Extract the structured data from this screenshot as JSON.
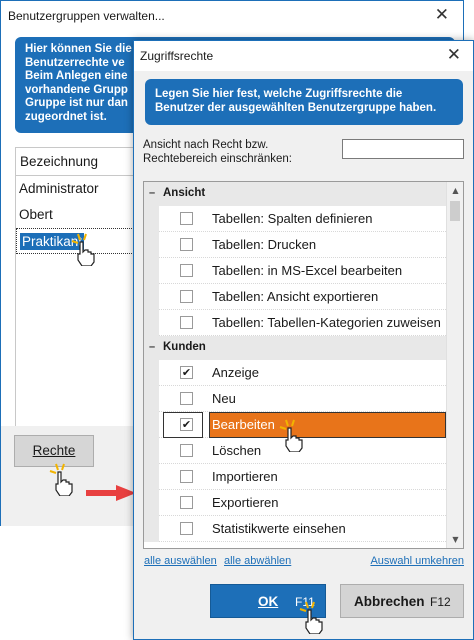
{
  "back_window": {
    "title": "Benutzergruppen verwalten...",
    "info_lines": [
      "Hier können Sie die",
      "Benutzerrechte ve",
      "Beim Anlegen eine",
      "vorhandene Grupp",
      "Gruppe ist nur dan",
      "zugeordnet ist."
    ],
    "column_header": "Bezeichnung",
    "groups": [
      "Administrator",
      "Obert",
      "Praktikant"
    ],
    "rechte_button": "Rechte"
  },
  "dialog": {
    "title": "Zugriffsrechte",
    "info_text": "Legen Sie hier fest, welche Zugriffsrechte die Benutzer der ausgewählten Benutzergruppe haben.",
    "filter_label": "Ansicht nach Recht bzw. Rechtebereich einschränken:",
    "filter_value": "",
    "sections": [
      {
        "name": "Ansicht",
        "items": [
          {
            "label": "Tabellen: Spalten definieren",
            "checked": false
          },
          {
            "label": "Tabellen: Drucken",
            "checked": false
          },
          {
            "label": "Tabellen: in MS-Excel bearbeiten",
            "checked": false
          },
          {
            "label": "Tabellen: Ansicht exportieren",
            "checked": false
          },
          {
            "label": "Tabellen: Tabellen-Kategorien zuweisen",
            "checked": false
          }
        ]
      },
      {
        "name": "Kunden",
        "items": [
          {
            "label": "Anzeige",
            "checked": true
          },
          {
            "label": "Neu",
            "checked": false
          },
          {
            "label": "Bearbeiten",
            "checked": true,
            "highlighted": true
          },
          {
            "label": "Löschen",
            "checked": false
          },
          {
            "label": "Importieren",
            "checked": false
          },
          {
            "label": "Exportieren",
            "checked": false
          },
          {
            "label": "Statistikwerte einsehen",
            "checked": false
          }
        ]
      }
    ],
    "links": {
      "select_all": "alle auswählen",
      "deselect_all": "alle abwählen",
      "invert": "Auswahl umkehren"
    },
    "ok_button": {
      "label": "OK",
      "key": "F11"
    },
    "cancel_button": {
      "label": "Abbrechen",
      "key": "F12"
    }
  },
  "colors": {
    "accent": "#1d6fb8",
    "highlight": "#e8741a",
    "arrow": "#e84040"
  }
}
